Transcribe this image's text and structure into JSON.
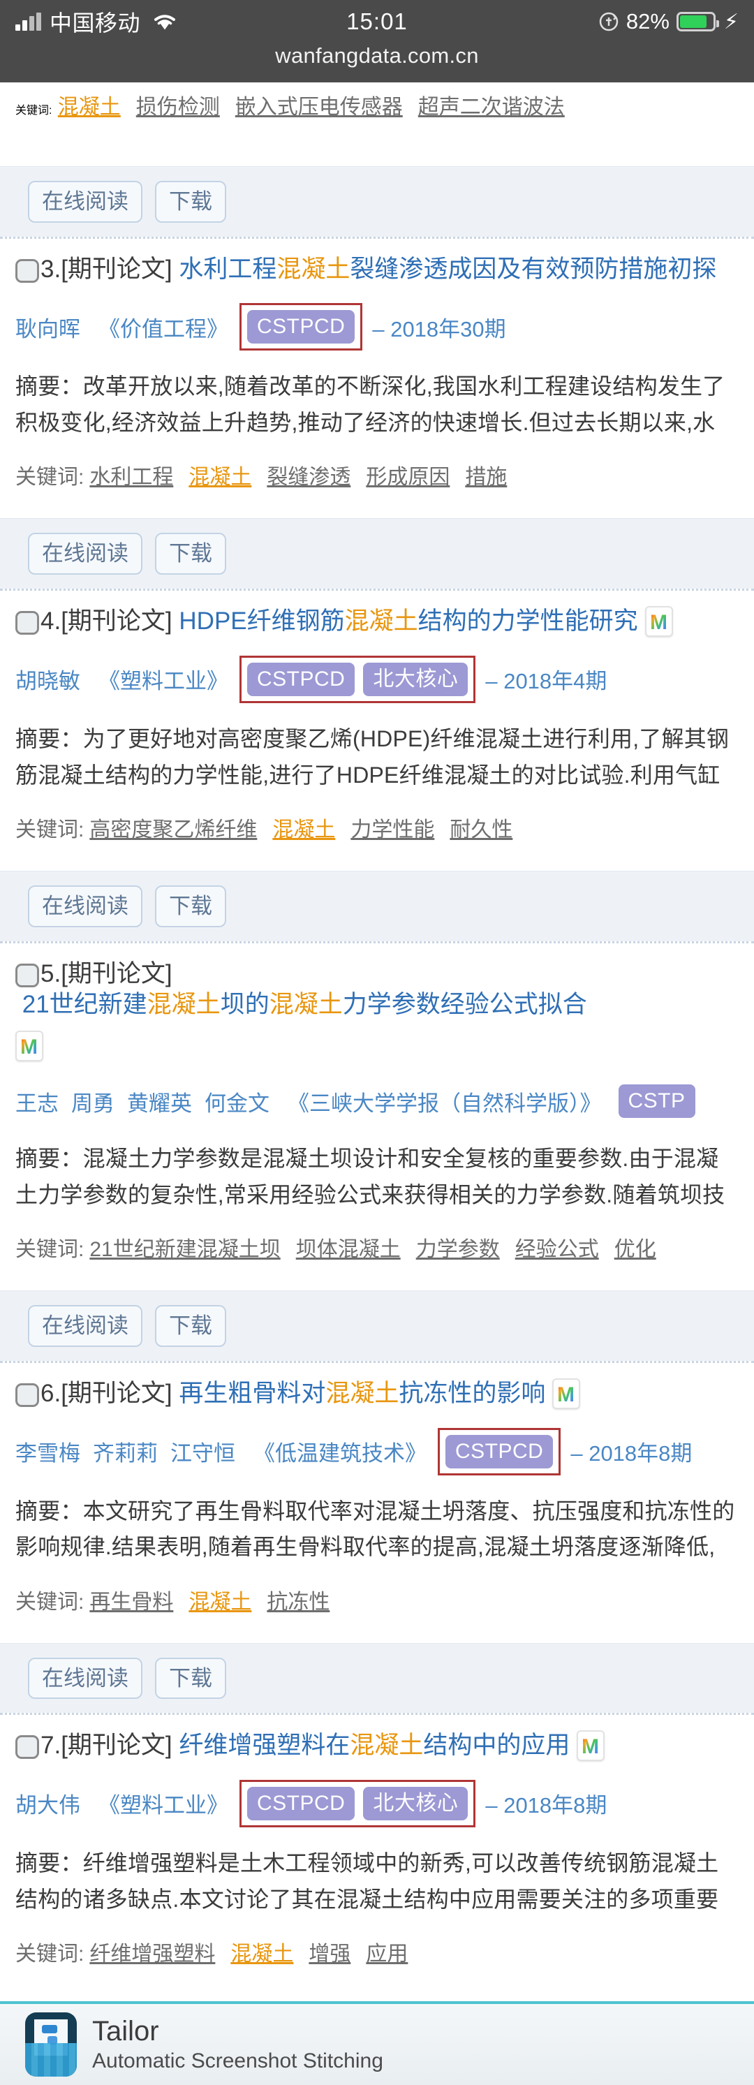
{
  "status_bar": {
    "carrier": "中国移动",
    "time": "15:01",
    "battery_percent": "82%",
    "signal_icon": "signal-bars-icon",
    "wifi_icon": "wifi-icon",
    "rotation_lock_icon": "rotation-lock-icon",
    "battery_icon": "battery-icon",
    "charging_icon": "lightning-bolt-icon"
  },
  "browser": {
    "url": "wanfangdata.com.cn"
  },
  "labels": {
    "keywords_label": "关键词:",
    "abstract_label": "摘要:",
    "read_online": "在线阅读",
    "download": "下载",
    "doc_type": "[期刊论文]",
    "m_badge_icon": "wanfang-m-icon",
    "checkbox_icon": "select-checkbox-icon"
  },
  "results": [
    {
      "id": "partial-top",
      "partial": true,
      "keywords": [
        {
          "text": "混凝土",
          "highlight": true
        },
        {
          "text": "损伤检测",
          "highlight": false
        },
        {
          "text": "嵌入式压电传感器",
          "highlight": false
        },
        {
          "text": "超声二次谐波法",
          "highlight": false
        }
      ]
    },
    {
      "id": "3",
      "index": "3.",
      "title_parts": [
        {
          "text": "水利工程",
          "highlight": false
        },
        {
          "text": "混凝土",
          "highlight": true
        },
        {
          "text": "裂缝渗透成因及有效预防措施初探",
          "highlight": false
        }
      ],
      "has_m_badge": false,
      "m_badge_wraps": false,
      "authors": [
        "耿向晖"
      ],
      "journal": "《价值工程》",
      "badges": [
        "CSTPCD"
      ],
      "badges_boxed": true,
      "issue": "– 2018年30期",
      "abstract": "摘要：改革开放以来,随着改革的不断深化,我国水利工程建设结构发生了积极变化,经济效益上升趋势,推动了经济的快速增长.但过去长期以来,水利工程建设中安全质量问题",
      "keywords": [
        {
          "text": "水利工程",
          "highlight": false
        },
        {
          "text": "混凝土",
          "highlight": true
        },
        {
          "text": "裂缝渗透",
          "highlight": false
        },
        {
          "text": "形成原因",
          "highlight": false
        },
        {
          "text": "措施",
          "highlight": false
        }
      ]
    },
    {
      "id": "4",
      "index": "4.",
      "title_parts": [
        {
          "text": "HDPE纤维钢筋",
          "highlight": false
        },
        {
          "text": "混凝土",
          "highlight": true
        },
        {
          "text": "结构的力学性能研究",
          "highlight": false
        }
      ],
      "has_m_badge": true,
      "m_badge_wraps": false,
      "authors": [
        "胡晓敏"
      ],
      "journal": "《塑料工业》",
      "badges": [
        "CSTPCD",
        "北大核心"
      ],
      "badges_boxed": true,
      "issue": "– 2018年4期",
      "abstract": "摘要：为了更好地对高密度聚乙烯(HDPE)纤维混凝土进行利用,了解其钢筋混凝土结构的力学性能,进行了HDPE纤维混凝土的对比试验.利用气缸及棱镜等设备,对两种混凝土的弹性模量",
      "keywords": [
        {
          "text": "高密度聚乙烯纤维",
          "highlight": false
        },
        {
          "text": "混凝土",
          "highlight": true
        },
        {
          "text": "力学性能",
          "highlight": false
        },
        {
          "text": "耐久性",
          "highlight": false
        }
      ]
    },
    {
      "id": "5",
      "index": "5.",
      "title_parts": [
        {
          "text": "21世纪新建",
          "highlight": false
        },
        {
          "text": "混凝土",
          "highlight": true
        },
        {
          "text": "坝的",
          "highlight": false
        },
        {
          "text": "混凝土",
          "highlight": true
        },
        {
          "text": "力学参数经验公式拟合",
          "highlight": false
        }
      ],
      "has_m_badge": true,
      "m_badge_wraps": true,
      "authors": [
        "王志",
        "周勇",
        "黄耀英",
        "何金文"
      ],
      "journal": "《三峡大学学报（自然科学版）》",
      "badges": [
        "CSTP"
      ],
      "badges_boxed": false,
      "issue": "",
      "abstract": "摘要：混凝土力学参数是混凝土坝设计和安全复核的重要参数.由于混凝土力学参数的复杂性,常采用经验公式来获得相关的力学参数.随着筑坝技术的不断提高,混凝土力学性能大幅提升",
      "keywords": [
        {
          "text": "21世纪新建混凝土坝",
          "highlight": false
        },
        {
          "text": "坝体混凝土",
          "highlight": false
        },
        {
          "text": "力学参数",
          "highlight": false
        },
        {
          "text": "经验公式",
          "highlight": false
        },
        {
          "text": "优化",
          "highlight": false
        }
      ]
    },
    {
      "id": "6",
      "index": "6.",
      "title_parts": [
        {
          "text": "再生粗骨料对",
          "highlight": false
        },
        {
          "text": "混凝土",
          "highlight": true
        },
        {
          "text": "抗冻性的影响",
          "highlight": false
        }
      ],
      "has_m_badge": true,
      "m_badge_wraps": false,
      "authors": [
        "李雪梅",
        "齐莉莉",
        "江守恒"
      ],
      "journal": "《低温建筑技术》",
      "badges": [
        "CSTPCD"
      ],
      "badges_boxed": true,
      "issue": "– 2018年8期",
      "abstract": "摘要：本文研究了再生骨料取代率对混凝土坍落度、抗压强度和抗冻性的影响规律.结果表明,随着再生骨料取代率的提高,混凝土坍落度逐渐降低,抗压强度亦逐渐降低,混凝土相对动弹",
      "keywords": [
        {
          "text": "再生骨料",
          "highlight": false
        },
        {
          "text": "混凝土",
          "highlight": true
        },
        {
          "text": "抗冻性",
          "highlight": false
        }
      ]
    },
    {
      "id": "7",
      "index": "7.",
      "title_parts": [
        {
          "text": "纤维增强塑料在",
          "highlight": false
        },
        {
          "text": "混凝土",
          "highlight": true
        },
        {
          "text": "结构中的应用",
          "highlight": false
        }
      ],
      "has_m_badge": true,
      "m_badge_wraps": false,
      "authors": [
        "胡大伟"
      ],
      "journal": "《塑料工业》",
      "badges": [
        "CSTPCD",
        "北大核心"
      ],
      "badges_boxed": true,
      "issue": "– 2018年8期",
      "abstract": "摘要：纤维增强塑料是土木工程领域中的新秀,可以改善传统钢筋混凝土结构的诸多缺点.本文讨论了其在混凝土结构中应用需要关注的多项重要性能以及纤维增强塑料在结构中的应用",
      "keywords": [
        {
          "text": "纤维增强塑料",
          "highlight": false
        },
        {
          "text": "混凝土",
          "highlight": true
        },
        {
          "text": "增强",
          "highlight": false
        },
        {
          "text": "应用",
          "highlight": false
        }
      ]
    }
  ],
  "footer": {
    "app_name": "Tailor",
    "tagline": "Automatic Screenshot Stitching",
    "app_icon": "tailor-app-icon",
    "accent_color": "#4ec3d0"
  }
}
